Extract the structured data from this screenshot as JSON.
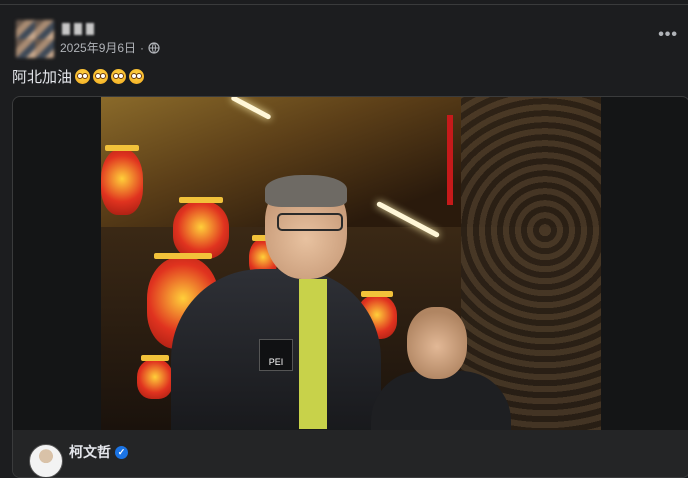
{
  "post": {
    "date": "2025年9月6日",
    "separator": "·",
    "privacy_icon": "globe-icon",
    "more_label": "•••",
    "caption": "阿北加油",
    "caption_emoji": [
      "pleading-face-emoji",
      "pleading-face-emoji",
      "pleading-face-emoji",
      "pleading-face-emoji"
    ]
  },
  "shared": {
    "author_name": "柯文哲",
    "verified_icon": "verified-badge-icon",
    "verified_glyph": "✓",
    "jacket_text": "PEI"
  },
  "colors": {
    "background": "#1c1d1f",
    "text": "#e4e6eb",
    "muted": "#b0b3b8",
    "verified": "#1b74e4"
  }
}
